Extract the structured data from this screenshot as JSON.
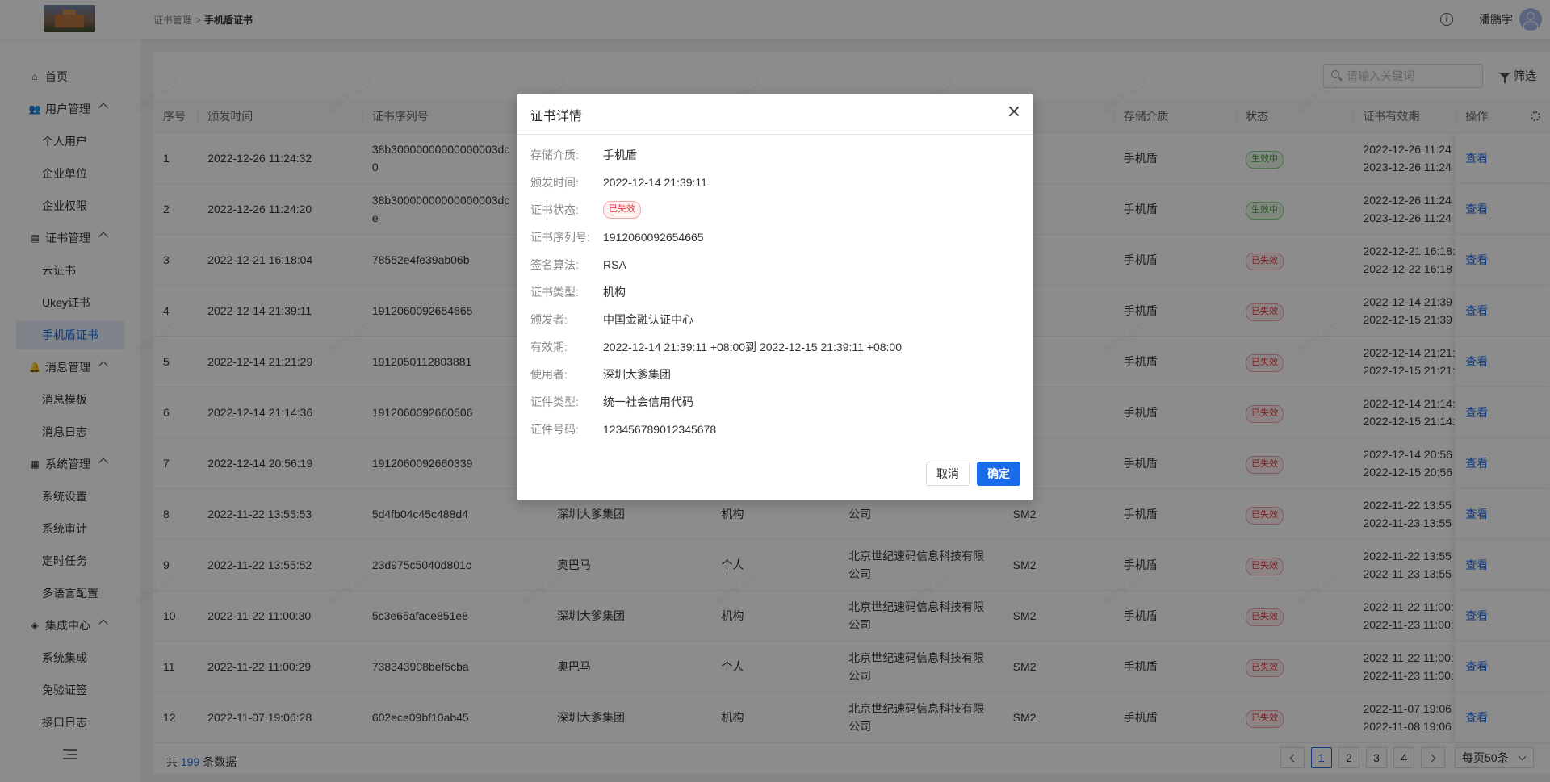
{
  "header": {
    "breadcrumb": [
      "证书管理",
      "手机盾证书"
    ],
    "breadcrumb_sep": ">",
    "username": "潘鹏宇",
    "info_icon": "info-icon",
    "avatar_icon": "user-avatar-icon"
  },
  "sidebar": {
    "home": "首页",
    "groups": [
      {
        "label": "用户管理",
        "icon": "users-icon",
        "items": [
          "个人用户",
          "企业单位",
          "企业权限"
        ]
      },
      {
        "label": "证书管理",
        "icon": "certificate-icon",
        "items": [
          "云证书",
          "Ukey证书",
          "手机盾证书"
        ]
      },
      {
        "label": "消息管理",
        "icon": "bell-icon",
        "items": [
          "消息模板",
          "消息日志"
        ]
      },
      {
        "label": "系统管理",
        "icon": "system-icon",
        "items": [
          "系统设置",
          "系统审计",
          "定时任务",
          "多语言配置"
        ]
      },
      {
        "label": "集成中心",
        "icon": "layers-icon",
        "items": [
          "系统集成",
          "免验证签",
          "接口日志"
        ]
      }
    ],
    "active": "手机盾证书"
  },
  "toolbar": {
    "search_placeholder": "请输入关键词",
    "filter_label": "筛选"
  },
  "table": {
    "columns": [
      "序号",
      "颁发时间",
      "证书序列号",
      "",
      "",
      "",
      "",
      "存储介质",
      "状态",
      "证书有效期",
      "操作"
    ],
    "rows": [
      {
        "no": "1",
        "time": "2022-12-26 11:24:32",
        "serial": "38b30000000000000003dc",
        "serial2": "0",
        "user": "",
        "type": "",
        "issuer": "",
        "issuer2": "",
        "algo": "",
        "media": "手机盾",
        "status": "生效中",
        "status_kind": "ok",
        "valid_from": "2022-12-26 11:24",
        "valid_to": "2023-12-26 11:24",
        "action": "查看"
      },
      {
        "no": "2",
        "time": "2022-12-26 11:24:20",
        "serial": "38b30000000000000003dc",
        "serial2": "e",
        "user": "",
        "type": "",
        "issuer": "",
        "issuer2": "",
        "algo": "",
        "media": "手机盾",
        "status": "生效中",
        "status_kind": "ok",
        "valid_from": "2022-12-26 11:24",
        "valid_to": "2023-12-26 11:24",
        "action": "查看"
      },
      {
        "no": "3",
        "time": "2022-12-21 16:18:04",
        "serial": "78552e4fe39ab06b",
        "serial2": "",
        "user": "",
        "type": "",
        "issuer": "",
        "issuer2": "",
        "algo": "",
        "media": "手机盾",
        "status": "已失效",
        "status_kind": "bad",
        "valid_from": "2022-12-21 16:18:",
        "valid_to": "2022-12-22 16:18",
        "action": "查看"
      },
      {
        "no": "4",
        "time": "2022-12-14 21:39:11",
        "serial": "1912060092654665",
        "serial2": "",
        "user": "",
        "type": "",
        "issuer": "",
        "issuer2": "",
        "algo": "",
        "media": "手机盾",
        "status": "已失效",
        "status_kind": "bad",
        "valid_from": "2022-12-14 21:39",
        "valid_to": "2022-12-15 21:39",
        "action": "查看"
      },
      {
        "no": "5",
        "time": "2022-12-14 21:21:29",
        "serial": "1912050112803881",
        "serial2": "",
        "user": "",
        "type": "",
        "issuer": "",
        "issuer2": "",
        "algo": "",
        "media": "手机盾",
        "status": "已失效",
        "status_kind": "bad",
        "valid_from": "2022-12-14 21:21:",
        "valid_to": "2022-12-15 21:21:",
        "action": "查看"
      },
      {
        "no": "6",
        "time": "2022-12-14 21:14:36",
        "serial": "1912060092660506",
        "serial2": "",
        "user": "",
        "type": "",
        "issuer": "",
        "issuer2": "",
        "algo": "",
        "media": "手机盾",
        "status": "已失效",
        "status_kind": "bad",
        "valid_from": "2022-12-14 21:14:",
        "valid_to": "2022-12-15 21:14:",
        "action": "查看"
      },
      {
        "no": "7",
        "time": "2022-12-14 20:56:19",
        "serial": "1912060092660339",
        "serial2": "",
        "user": "",
        "type": "",
        "issuer": "",
        "issuer2": "",
        "algo": "",
        "media": "手机盾",
        "status": "已失效",
        "status_kind": "bad",
        "valid_from": "2022-12-14 20:56",
        "valid_to": "2022-12-15 20:56",
        "action": "查看"
      },
      {
        "no": "8",
        "time": "2022-11-22 13:55:53",
        "serial": "5d4fb04c45c488d4",
        "serial2": "",
        "user": "深圳大爹集团",
        "type": "机构",
        "issuer": "",
        "issuer2": "公司",
        "algo": "SM2",
        "media": "手机盾",
        "status": "已失效",
        "status_kind": "bad",
        "valid_from": "2022-11-22 13:55",
        "valid_to": "2022-11-23 13:55",
        "action": "查看"
      },
      {
        "no": "9",
        "time": "2022-11-22 13:55:52",
        "serial": "23d975c5040d801c",
        "serial2": "",
        "user": "奥巴马",
        "type": "个人",
        "issuer": "北京世纪速码信息科技有限",
        "issuer2": "公司",
        "algo": "SM2",
        "media": "手机盾",
        "status": "已失效",
        "status_kind": "bad",
        "valid_from": "2022-11-22 13:55",
        "valid_to": "2022-11-23 13:55",
        "action": "查看"
      },
      {
        "no": "10",
        "time": "2022-11-22 11:00:30",
        "serial": "5c3e65aface851e8",
        "serial2": "",
        "user": "深圳大爹集团",
        "type": "机构",
        "issuer": "北京世纪速码信息科技有限",
        "issuer2": "公司",
        "algo": "SM2",
        "media": "手机盾",
        "status": "已失效",
        "status_kind": "bad",
        "valid_from": "2022-11-22 11:00:",
        "valid_to": "2022-11-23 11:00:",
        "action": "查看"
      },
      {
        "no": "11",
        "time": "2022-11-22 11:00:29",
        "serial": "738343908bef5cba",
        "serial2": "",
        "user": "奥巴马",
        "type": "个人",
        "issuer": "北京世纪速码信息科技有限",
        "issuer2": "公司",
        "algo": "SM2",
        "media": "手机盾",
        "status": "已失效",
        "status_kind": "bad",
        "valid_from": "2022-11-22 11:00:",
        "valid_to": "2022-11-23 11:00:",
        "action": "查看"
      },
      {
        "no": "12",
        "time": "2022-11-07 19:06:28",
        "serial": "602ece09bf10ab45",
        "serial2": "",
        "user": "深圳大爹集团",
        "type": "机构",
        "issuer": "北京世纪速码信息科技有限",
        "issuer2": "公司",
        "algo": "SM2",
        "media": "手机盾",
        "status": "已失效",
        "status_kind": "bad",
        "valid_from": "2022-11-07 19:06",
        "valid_to": "2022-11-08 19:06",
        "action": "查看"
      }
    ]
  },
  "footer": {
    "total_prefix": "共",
    "total": "199",
    "total_suffix": "条数据",
    "pages": [
      "1",
      "2",
      "3",
      "4"
    ],
    "current_page": "1",
    "page_size": "每页50条"
  },
  "watermark": "潘鹏宇 6219",
  "modal": {
    "title": "证书详情",
    "fields": [
      {
        "k": "存储介质:",
        "v": "手机盾"
      },
      {
        "k": "颁发时间:",
        "v": "2022-12-14 21:39:11"
      },
      {
        "k": "证书状态:",
        "v": "已失效",
        "tag": true
      },
      {
        "k": "证书序列号:",
        "v": "1912060092654665"
      },
      {
        "k": "签名算法:",
        "v": "RSA"
      },
      {
        "k": "证书类型:",
        "v": "机构"
      },
      {
        "k": "颁发者:",
        "v": "中国金融认证中心"
      },
      {
        "k": "有效期:",
        "v": "2022-12-14 21:39:11 +08:00到 2022-12-15 21:39:11 +08:00"
      },
      {
        "k": "使用者:",
        "v": "深圳大爹集团"
      },
      {
        "k": "证件类型:",
        "v": "统一社会信用代码"
      },
      {
        "k": "证件号码:",
        "v": "123456789012345678"
      }
    ],
    "cancel_label": "取消",
    "ok_label": "确定"
  }
}
